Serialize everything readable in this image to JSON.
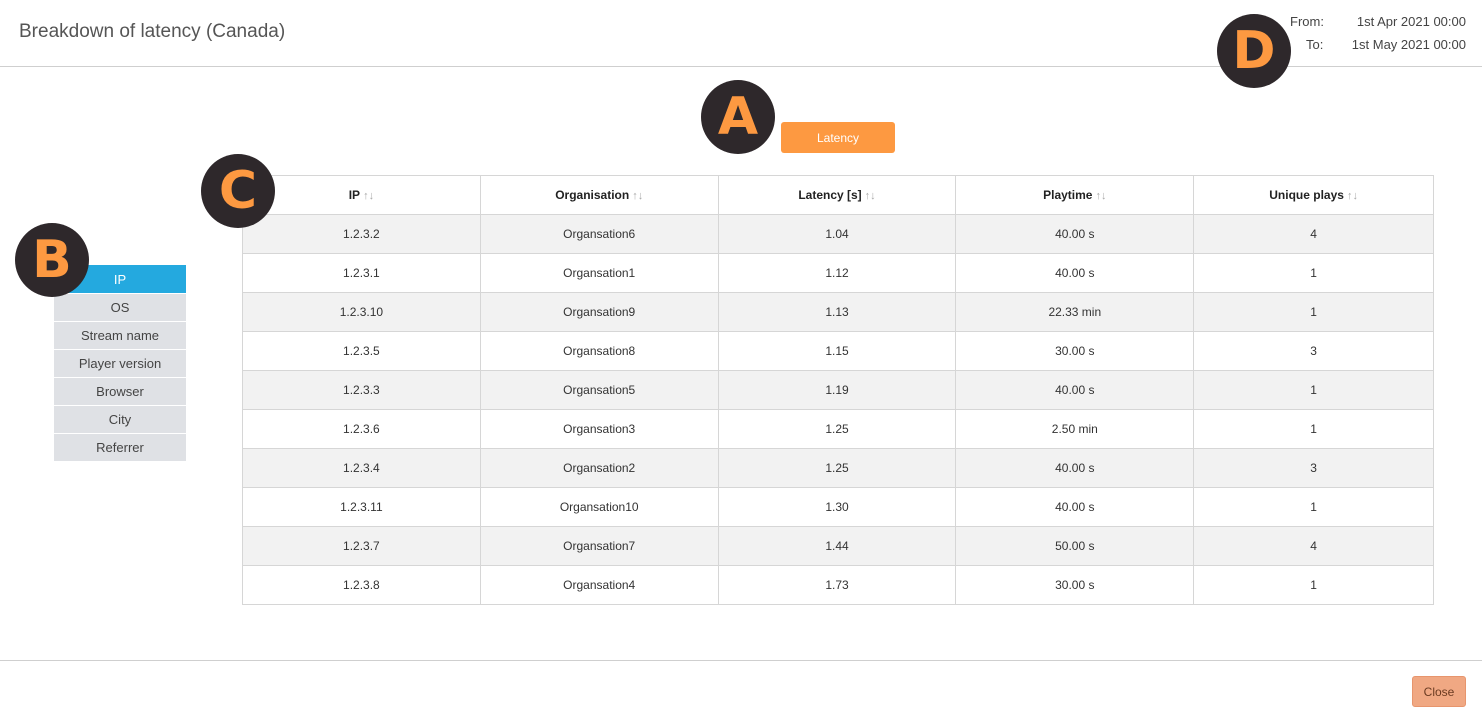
{
  "header": {
    "title": "Breakdown of latency (Canada)",
    "from_label": "From:",
    "from_value": "1st Apr 2021 00:00",
    "to_label": "To:",
    "to_value": "1st May 2021 00:00"
  },
  "metric_button": "Latency",
  "tabs": [
    {
      "label": "IP",
      "active": true
    },
    {
      "label": "OS",
      "active": false
    },
    {
      "label": "Stream name",
      "active": false
    },
    {
      "label": "Player version",
      "active": false
    },
    {
      "label": "Browser",
      "active": false
    },
    {
      "label": "City",
      "active": false
    },
    {
      "label": "Referrer",
      "active": false
    }
  ],
  "table": {
    "sort_glyph": "↑↓",
    "columns": [
      "IP",
      "Organisation",
      "Latency [s]",
      "Playtime",
      "Unique plays"
    ],
    "rows": [
      [
        "1.2.3.2",
        "Organsation6",
        "1.04",
        "40.00 s",
        "4"
      ],
      [
        "1.2.3.1",
        "Organsation1",
        "1.12",
        "40.00 s",
        "1"
      ],
      [
        "1.2.3.10",
        "Organsation9",
        "1.13",
        "22.33 min",
        "1"
      ],
      [
        "1.2.3.5",
        "Organsation8",
        "1.15",
        "30.00 s",
        "3"
      ],
      [
        "1.2.3.3",
        "Organsation5",
        "1.19",
        "40.00 s",
        "1"
      ],
      [
        "1.2.3.6",
        "Organsation3",
        "1.25",
        "2.50 min",
        "1"
      ],
      [
        "1.2.3.4",
        "Organsation2",
        "1.25",
        "40.00 s",
        "3"
      ],
      [
        "1.2.3.11",
        "Organsation10",
        "1.30",
        "40.00 s",
        "1"
      ],
      [
        "1.2.3.7",
        "Organsation7",
        "1.44",
        "50.00 s",
        "4"
      ],
      [
        "1.2.3.8",
        "Organsation4",
        "1.73",
        "30.00 s",
        "1"
      ]
    ]
  },
  "annotations": {
    "a": "A",
    "b": "B",
    "c": "C",
    "d": "D"
  },
  "footer": {
    "close_label": "Close"
  },
  "colors": {
    "accent_orange": "#fd9941",
    "active_tab_blue": "#24a9df",
    "badge_dark": "#2e282b",
    "close_button": "#f0a883"
  }
}
